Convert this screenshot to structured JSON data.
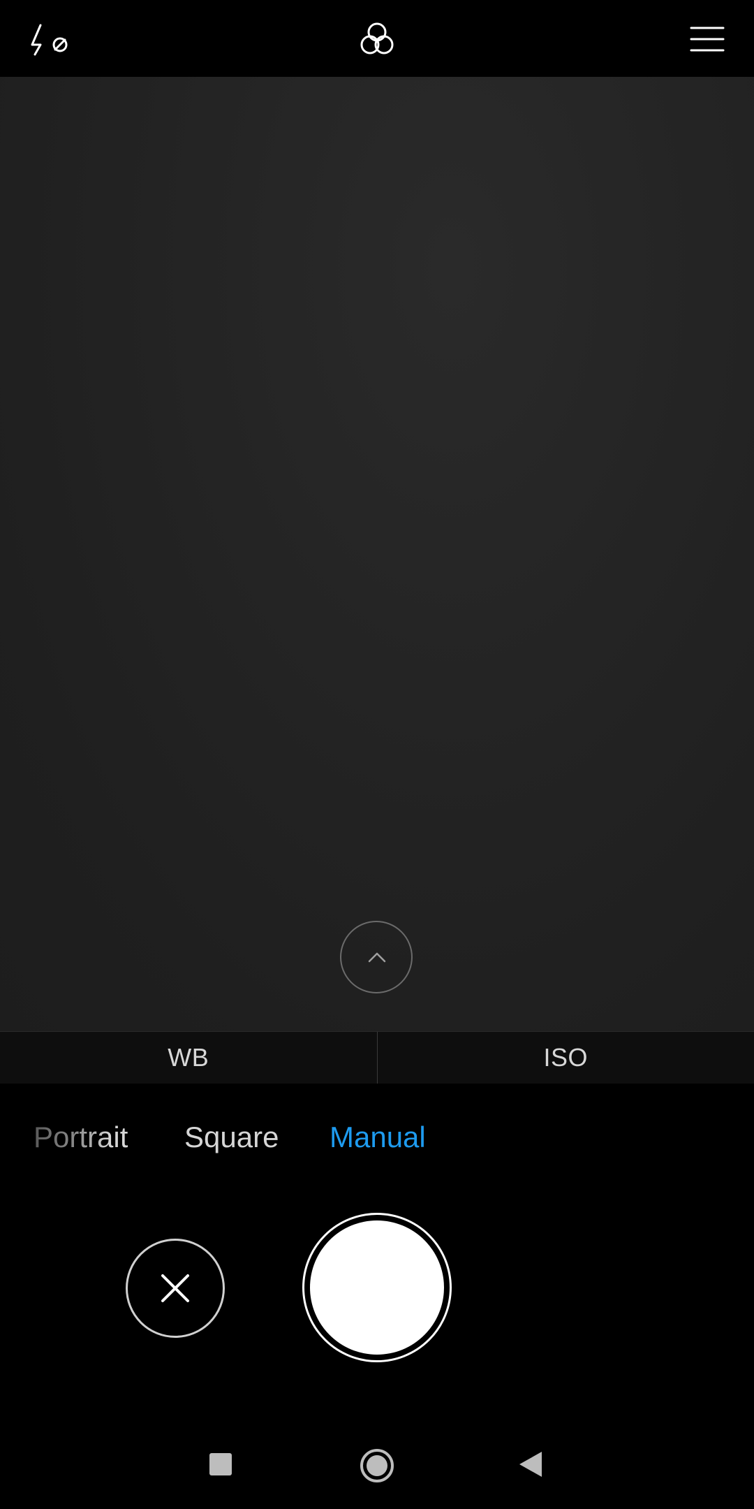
{
  "top_bar": {
    "flash_icon": "flash-off-icon",
    "filters_icon": "filters-icon",
    "menu_icon": "menu-icon"
  },
  "viewfinder": {
    "expand_icon": "chevron-up-icon"
  },
  "settings": {
    "wb_label": "WB",
    "iso_label": "ISO"
  },
  "modes": {
    "items": [
      "Portrait",
      "Square",
      "Manual"
    ],
    "selected": "Manual",
    "selected_color": "#1e9bef"
  },
  "controls": {
    "cancel_icon": "close-icon",
    "shutter_icon": "shutter-icon"
  },
  "nav": {
    "recents_icon": "square-recents-icon",
    "home_icon": "circle-home-icon",
    "back_icon": "triangle-back-icon"
  }
}
